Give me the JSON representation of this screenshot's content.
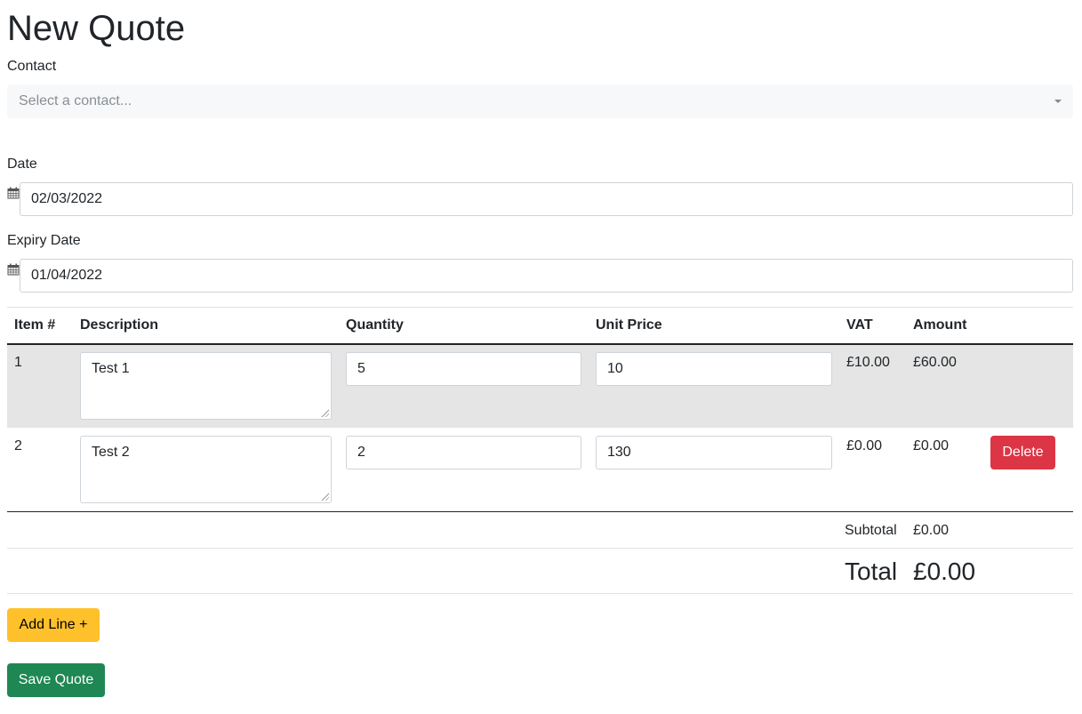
{
  "page": {
    "title": "New Quote"
  },
  "contact": {
    "label": "Contact",
    "placeholder": "Select a contact..."
  },
  "date": {
    "label": "Date",
    "value": "02/03/2022"
  },
  "expiry_date": {
    "label": "Expiry Date",
    "value": "01/04/2022"
  },
  "table": {
    "headers": {
      "item": "Item #",
      "description": "Description",
      "quantity": "Quantity",
      "unit_price": "Unit Price",
      "vat": "VAT",
      "amount": "Amount"
    },
    "rows": [
      {
        "item": "1",
        "description": "Test 1",
        "quantity": "5",
        "unit_price": "10",
        "vat": "£10.00",
        "amount": "£60.00",
        "highlighted": true
      },
      {
        "item": "2",
        "description": "Test 2",
        "quantity": "2",
        "unit_price": "130",
        "vat": "£0.00",
        "amount": "£0.00",
        "delete_label": "Delete"
      }
    ],
    "subtotal_label": "Subtotal",
    "subtotal_value": "£0.00",
    "total_label": "Total",
    "total_value": "£0.00"
  },
  "actions": {
    "add_line_label": "Add Line +",
    "save_label": "Save Quote"
  },
  "colors": {
    "danger": "#dc3545",
    "warning": "#ffc12b",
    "success": "#1f8753",
    "row_highlight": "#e5e5e5"
  }
}
